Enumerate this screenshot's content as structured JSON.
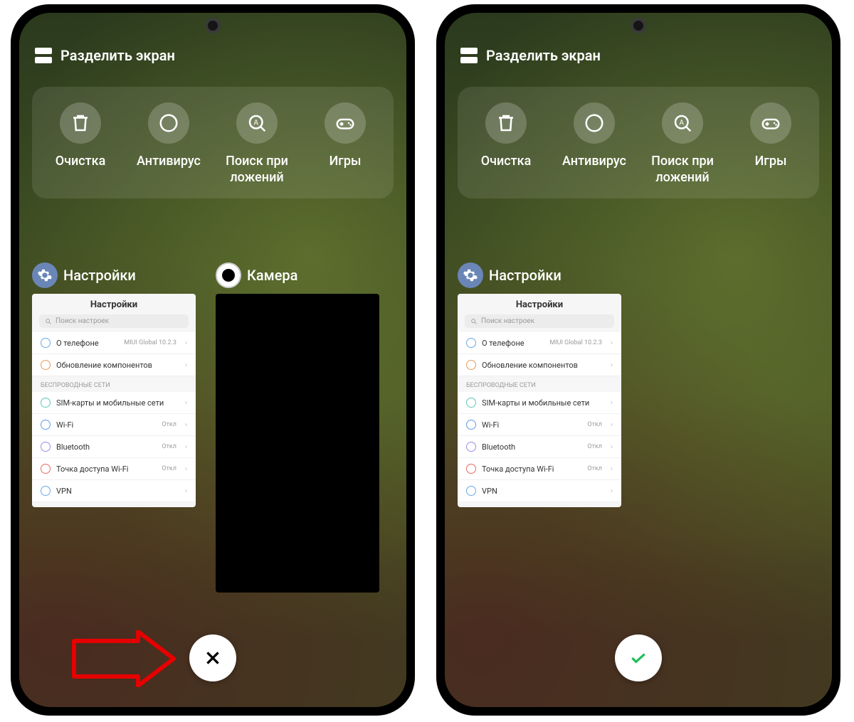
{
  "split_label": "Разделить экран",
  "tools": [
    {
      "id": "cleaner",
      "label": "Очистка"
    },
    {
      "id": "antivirus",
      "label": "Антивирус"
    },
    {
      "id": "appsearch",
      "label": "Поиск при\nложений"
    },
    {
      "id": "games",
      "label": "Игры"
    }
  ],
  "apps": {
    "settings": {
      "title": "Настройки",
      "card_title": "Настройки",
      "search_placeholder": "Поиск настроек",
      "rows": [
        {
          "label": "О телефоне",
          "value": "MIUI Global 10.2.3"
        },
        {
          "label": "Обновление компонентов",
          "value": ""
        }
      ],
      "section": "БЕСПРОВОДНЫЕ СЕТИ",
      "rows2": [
        {
          "label": "SIM-карты и мобильные сети",
          "value": ""
        },
        {
          "label": "Wi-Fi",
          "value": "Откл"
        },
        {
          "label": "Bluetooth",
          "value": "Откл"
        },
        {
          "label": "Точка доступа Wi-Fi",
          "value": "Откл"
        },
        {
          "label": "VPN",
          "value": ""
        }
      ]
    },
    "camera": {
      "title": "Камера"
    }
  }
}
